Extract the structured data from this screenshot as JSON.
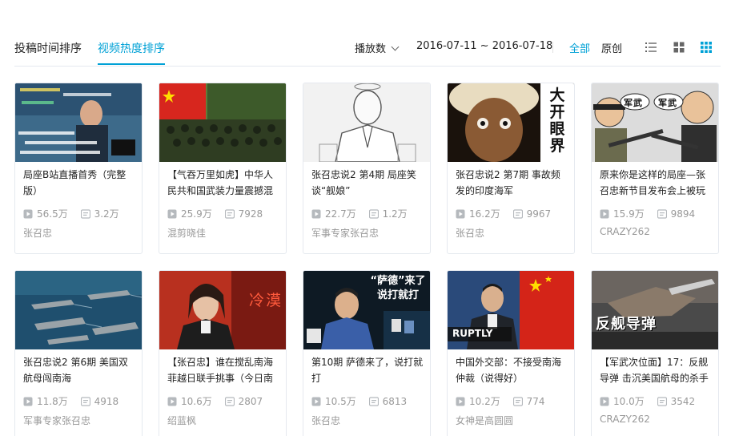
{
  "sort_tabs": [
    "投稿时间排序",
    "视频热度排序"
  ],
  "order_by": "播放数",
  "date_range": "2016-07-11 ~ 2016-07-18",
  "filters": [
    "全部",
    "原创"
  ],
  "colors": {
    "accent": "#00a1d6",
    "text": "#222222",
    "muted": "#999999",
    "border": "#e5e9ef"
  },
  "icons": {
    "play": "play-count-icon",
    "danmaku": "danmaku-count-icon",
    "list": "list-view-icon",
    "grid": "grid-view-icon",
    "dense": "dense-grid-icon"
  },
  "videos": [
    {
      "title": "局座B站直播首秀（完整版）",
      "plays": "56.5万",
      "danmaku": "3.2万",
      "uploader": "张召忠"
    },
    {
      "title": "【气吞万里如虎】中华人民共和国武装力量震撼混",
      "plays": "25.9万",
      "danmaku": "7928",
      "uploader": "混剪晓佳"
    },
    {
      "title": "张召忠说2 第4期 局座笑谈“舰娘”",
      "plays": "22.7万",
      "danmaku": "1.2万",
      "uploader": "军事专家张召忠"
    },
    {
      "title": "张召忠说2 第7期 事故频发的印度海军",
      "plays": "16.2万",
      "danmaku": "9967",
      "uploader": "张召忠",
      "thumb_text": "大开眼界"
    },
    {
      "title": "原来你是这样的局座—张召忠新节目发布会上被玩",
      "plays": "15.9万",
      "danmaku": "9894",
      "uploader": "CRAZY262",
      "thumb_text": "军武"
    },
    {
      "title": "张召忠说2 第6期 美国双航母闯南海",
      "plays": "11.8万",
      "danmaku": "4918",
      "uploader": "军事专家张召忠"
    },
    {
      "title": "【张召忠】谁在搅乱南海菲越日联手挑事（今日南",
      "plays": "10.6万",
      "danmaku": "2807",
      "uploader": "绍蓝枫",
      "thumb_text": "冷漠"
    },
    {
      "title": "第10期 萨德来了，说打就打",
      "plays": "10.5万",
      "danmaku": "6813",
      "uploader": "张召忠",
      "thumb_text": "“萨德”来了 说打就打"
    },
    {
      "title": "中国外交部：不接受南海仲裁（说得好）",
      "plays": "10.2万",
      "danmaku": "774",
      "uploader": "女神是高圆圆",
      "thumb_text": "RUPTLY"
    },
    {
      "title": "【军武次位面】17：反舰导弹 击沉美国航母的杀手",
      "plays": "10.0万",
      "danmaku": "3542",
      "uploader": "CRAZY262",
      "thumb_text": "反舰导弹"
    }
  ]
}
